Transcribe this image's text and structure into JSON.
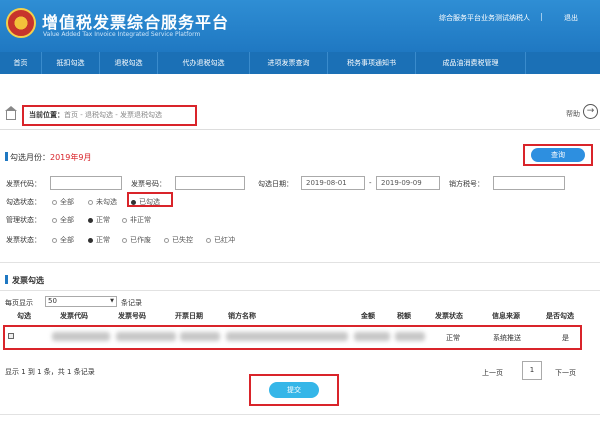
{
  "app": {
    "title": "增值税发票综合服务平台",
    "subtitle": "Value Added Tax Invoice Integrated Service Platform",
    "user_info": "综合服务平台业务测试纳税人",
    "separator": "|",
    "logout": "退出"
  },
  "nav": {
    "items": [
      {
        "label": "首页"
      },
      {
        "label": "抵扣勾选"
      },
      {
        "label": "退税勾选"
      },
      {
        "label": "代办退税勾选"
      },
      {
        "label": "进项发票查询"
      },
      {
        "label": "税务事项通知书"
      },
      {
        "label": "成品油消费税管理"
      }
    ]
  },
  "breadcrumb": {
    "prefix": "当前位置：",
    "path": "首页 - 退税勾选 - 发票退税勾选"
  },
  "help": {
    "label": "帮助"
  },
  "filter": {
    "section_title": "勾选月份：",
    "month_value": "2019年9月",
    "query_button": "查询",
    "invoice_code_label": "发票代码：",
    "invoice_number_label": "发票号码：",
    "date_label": "勾选日期：",
    "date_start": "2019-08-01",
    "date_dash": "-",
    "date_end": "2019-09-09",
    "seller_tax_label": "销方税号：",
    "check_status_label": "勾选状态：",
    "check_status_options": [
      "全部",
      "未勾选",
      "已勾选"
    ],
    "manage_status_label": "管理状态：",
    "manage_status_options": [
      "全部",
      "正常",
      "非正常"
    ],
    "invoice_status_label": "发票状态：",
    "invoice_status_options": [
      "全部",
      "正常",
      "已作废",
      "已失控",
      "已红冲"
    ]
  },
  "list": {
    "section_title": "发票勾选",
    "page_size_prefix": "每页显示",
    "page_size": "50",
    "page_size_suffix": "条记录",
    "headers": [
      "勾选",
      "发票代码",
      "发票号码",
      "开票日期",
      "销方名称",
      "金额",
      "税额",
      "发票状态",
      "信息来源",
      "是否勾选"
    ],
    "row": {
      "invoice_status": "正常",
      "source": "系统推送",
      "checked": "是"
    },
    "summary": "显示 1 到 1 条，共 1 条记录",
    "prev": "上一页",
    "page": "1",
    "next": "下一页",
    "submit": "提交"
  },
  "colors": {
    "header_blue": "#1f78c2",
    "highlight_red": "#d9242a",
    "month_red": "#d9242a",
    "submit_cyan": "#35b6e8"
  }
}
